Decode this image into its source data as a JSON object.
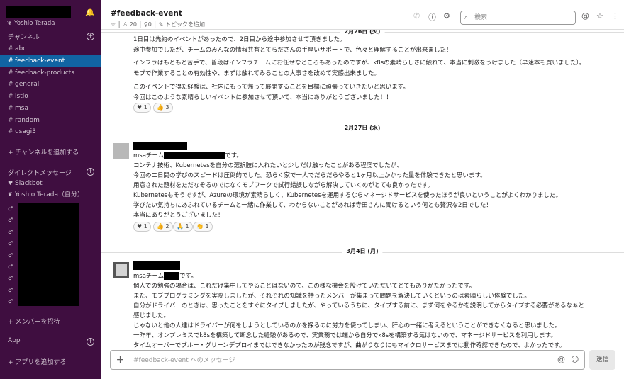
{
  "sidebar": {
    "user": "Yoshio Terada",
    "channels_heading": "チャンネル",
    "channels": [
      "abc",
      "feedback-event",
      "feedback-products",
      "general",
      "istio",
      "msa",
      "random",
      "usagi3"
    ],
    "add_channel": "+ チャンネルを追加する",
    "dm_heading": "ダイレクトメッセージ",
    "dms": [
      "Slackbot",
      "Yoshio Terada（自分）"
    ],
    "invite": "+ メンバーを招待",
    "app_heading": "App",
    "add_app": "+ アプリを追加する"
  },
  "header": {
    "channel": "#feedback-event",
    "members": "20",
    "pins": "0",
    "topic": "トピックを追加",
    "search_placeholder": "検索"
  },
  "dates": [
    "2月26日 (火)",
    "2月27日 (水)",
    "3月4日 (月)"
  ],
  "msg1": {
    "lines": [
      "1日目は先約のイベントがあったので、2日目から途中参加させて頂きました。",
      "途中参加でしたが、チームのみんなの情報共有とてらださんの手厚いサポートで、色々と理解することが出来ました！",
      "インフラはもともと苦手で、普段はインフラチームにお任せなところもあったのですが、k8sの素晴らしさに触れて、本当に刺激をうけました（早速本も買いました）。",
      "モブで作業することの有効性や、まずは触れてみることの大事さを改めて実感出来ました。",
      "このイベントで得た経験は、社内にもって帰って展開することを目標に頑張っていきたいと思います。",
      "今回はこのような素晴らしいイベントに参加させて頂いて、本当にありがとうございました！！"
    ],
    "reactions": [
      "1",
      "3"
    ]
  },
  "msg2": {
    "prefix": "msaチーム",
    "suffix": "です。",
    "lines": [
      "コンテナ技術、Kubernetesを自分の選択肢に入れたいと少しだけ触ったことがある程度でしたが、",
      "今回の二日間の学びのスピードは圧倒的でした。恐らく家で一人でだらだらやると1ヶ月以上かかった量を体験できたと思います。",
      "用意された題材をただなぞるのではなくモブワークで試行錯誤しながら解決していくのがとても良かったです。",
      "Kubernetesもそうですが、Azureの環境が素晴らしく、Kubernetesを運用するならマネージドサービスを使ったほうが良いということがよくわかりました。",
      "学びたい気持ちにあふれているチームと一緒に作業して、わからないことがあれば寺田さんに聞けるという何とも贅沢な2日でした！",
      "本当にありがとうございました！"
    ],
    "reactions": [
      "1",
      "2",
      "1",
      "1"
    ]
  },
  "msg3": {
    "prefix": "msaチーム",
    "suffix": "です。",
    "lines": [
      "個人での勉強の場合は、これだけ集中してやることはないので、この様な機会を設けていただいてとてもありがたかったです。",
      "また、モブプログラミングを実際しましたが、それぞれの知識を持ったメンバーが集まって問題を解決していくというのは素晴らしい体験でした。",
      "自分がドライバーのときは、思ったことをすぐにタイプしましたが、やっているうちに、タイプする前に、まず何をやるかを説明してからタイプする必要があるなぁと",
      "感じました。",
      "じゃないと他の人達はドライバーが何をしようとしているのかを探るのに労力を使ってしまい、肝心の一緒に考えるということができなくなると思いました。",
      "一昨年、オンプレミスでk8sを構築して断念した経験があるので、実業務では端から自分でk8sを構築する気はないので、マネージドサービスを利用します。",
      "タイムオーバーでブルー・グリーンデプロイまではできなかったのが残念ですが、曲がりなりにもマイクロサービスまでは動作確認できたので、よかったです。"
    ]
  },
  "composer": {
    "placeholder": "#feedback-event へのメッセージ",
    "send": "送信"
  }
}
